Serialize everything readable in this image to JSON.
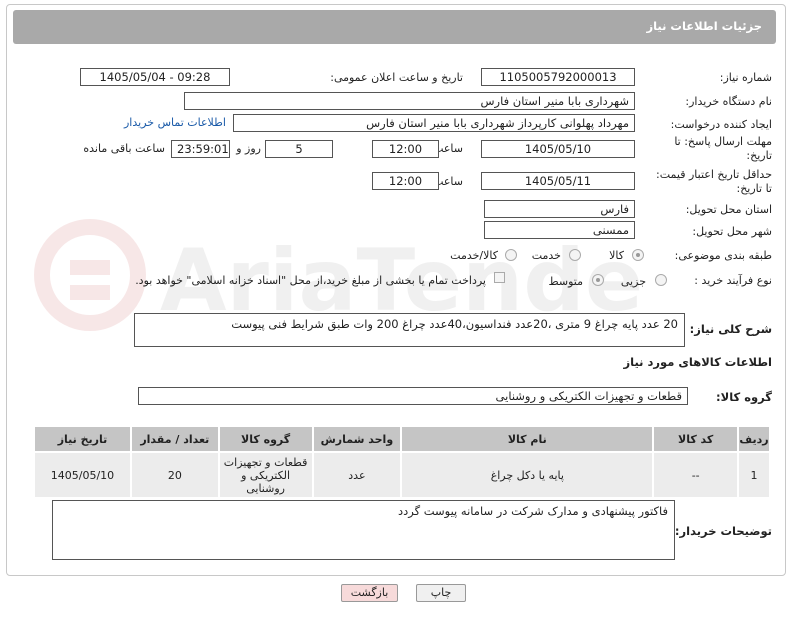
{
  "page": {
    "header_title": "جزئیات اطلاعات نیاز"
  },
  "form": {
    "need_number": {
      "label": "شماره نیاز:",
      "value": "1105005792000013"
    },
    "announce_datetime": {
      "label": "تاریخ و ساعت اعلان عمومی:",
      "value": "1405/05/04 - 09:28"
    },
    "buyer_org": {
      "label": "نام دستگاه خریدار:",
      "value": "شهرداری بابا منیر استان فارس"
    },
    "requester": {
      "label": "ایجاد کننده درخواست:",
      "value": "مهرداد پهلوانی کارپرداز شهرداری بابا منیر استان فارس",
      "contact_link": "اطلاعات تماس خریدار"
    },
    "reply_deadline": {
      "label_line1": "مهلت ارسال پاسخ: تا",
      "label_line2": "تاریخ:",
      "date": "1405/05/10",
      "time_label": "ساعت",
      "time": "12:00",
      "days": "5",
      "days_label": "روز و",
      "remaining": "23:59:01",
      "remaining_label": "ساعت باقی مانده"
    },
    "price_validity": {
      "label_line1": "حداقل تاریخ اعتبار قیمت:",
      "label_line2": "تا تاریخ:",
      "date": "1405/05/11",
      "time_label": "ساعت",
      "time": "12:00"
    },
    "delivery_province": {
      "label": "استان محل تحویل:",
      "value": "فارس"
    },
    "delivery_city": {
      "label": "شهر محل تحویل:",
      "value": "ممسنی"
    },
    "category": {
      "label": "طبقه بندی موضوعی:",
      "options": [
        "کالا",
        "خدمت",
        "کالا/خدمت"
      ],
      "selected": "کالا"
    },
    "process_type": {
      "label": "نوع فرآیند خرید :",
      "options": [
        "جزیی",
        "متوسط"
      ],
      "selected": "متوسط",
      "payment_note": "پرداخت تمام یا بخشی از مبلغ خرید،از محل \"اسناد خزانه اسلامی\" خواهد بود."
    }
  },
  "description": {
    "label": "شرح کلی نیاز:",
    "text": "20 عدد پایه چراغ 9 متری ،20عدد فنداسیون،40عدد چراغ 200 وات طبق شرایط فنی پیوست"
  },
  "goods_info": {
    "section_title": "اطلاعات کالاهای مورد نیاز",
    "group_label": "گروه کالا:",
    "group_value": "قطعات و تجهیزات الکتریکی و روشنایی",
    "columns": [
      "ردیف",
      "کد کالا",
      "نام کالا",
      "واحد شمارش",
      "گروه کالا",
      "تعداد / مقدار",
      "تاریخ نیاز"
    ],
    "rows": [
      {
        "row": "1",
        "code": "--",
        "name": "پایه یا دکل چراغ",
        "unit": "عدد",
        "group": "قطعات و تجهیزات الکتریکی و روشنایی",
        "qty": "20",
        "date": "1405/05/10"
      }
    ]
  },
  "buyer_notes": {
    "label": "توضیحات خریدار:",
    "text": "فاکتور پیشنهادی و مدارک شرکت در سامانه پیوست گردد"
  },
  "buttons": {
    "print": "چاپ",
    "back": "بازگشت"
  },
  "watermark": "AriaTender.neT"
}
